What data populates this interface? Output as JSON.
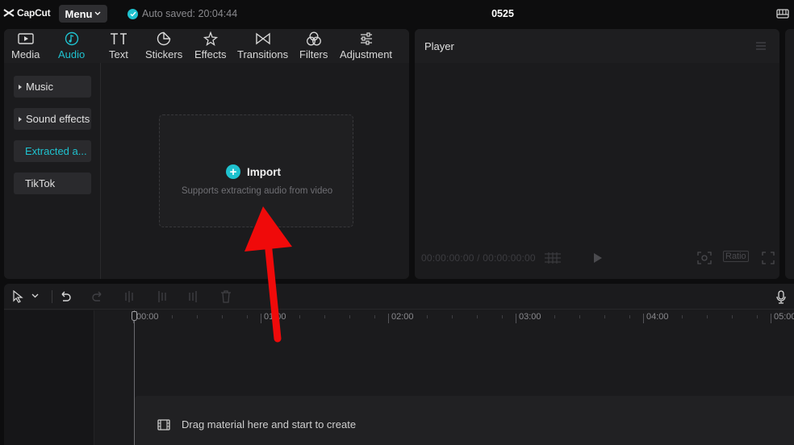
{
  "app": {
    "logo_text": "CapCut",
    "menu_label": "Menu",
    "autosave_text": "Auto saved: 20:04:44",
    "project_title": "0525"
  },
  "tabs": [
    {
      "label": "Media",
      "icon": "media-icon"
    },
    {
      "label": "Audio",
      "icon": "audio-note-icon",
      "active": true
    },
    {
      "label": "Text",
      "icon": "text-icon"
    },
    {
      "label": "Stickers",
      "icon": "sticker-icon"
    },
    {
      "label": "Effects",
      "icon": "effects-star-icon"
    },
    {
      "label": "Transitions",
      "icon": "transition-bowtie-icon"
    },
    {
      "label": "Filters",
      "icon": "filters-icon"
    },
    {
      "label": "Adjustment",
      "icon": "adjustment-sliders-icon"
    }
  ],
  "sidebar": {
    "items": [
      {
        "label": "Music",
        "expandable": true
      },
      {
        "label": "Sound effects",
        "expandable": true
      },
      {
        "label": "Extracted a...",
        "selected": true
      },
      {
        "label": "TikTok"
      }
    ]
  },
  "import": {
    "label": "Import",
    "subtitle": "Supports extracting audio from video"
  },
  "player": {
    "title": "Player",
    "timecode": "00:00:00:00 / 00:00:00:00",
    "ratio_label": "Ratio"
  },
  "timeline": {
    "ruler_labels": [
      "00:00",
      "01:00",
      "02:00",
      "03:00",
      "04:00",
      "05:00"
    ],
    "drag_hint": "Drag material here and start to create"
  },
  "colors": {
    "accent": "#1fc2cf",
    "annotation_arrow": "#f00a0a",
    "background": "#0d0d0e",
    "panel": "#1b1b1d"
  }
}
